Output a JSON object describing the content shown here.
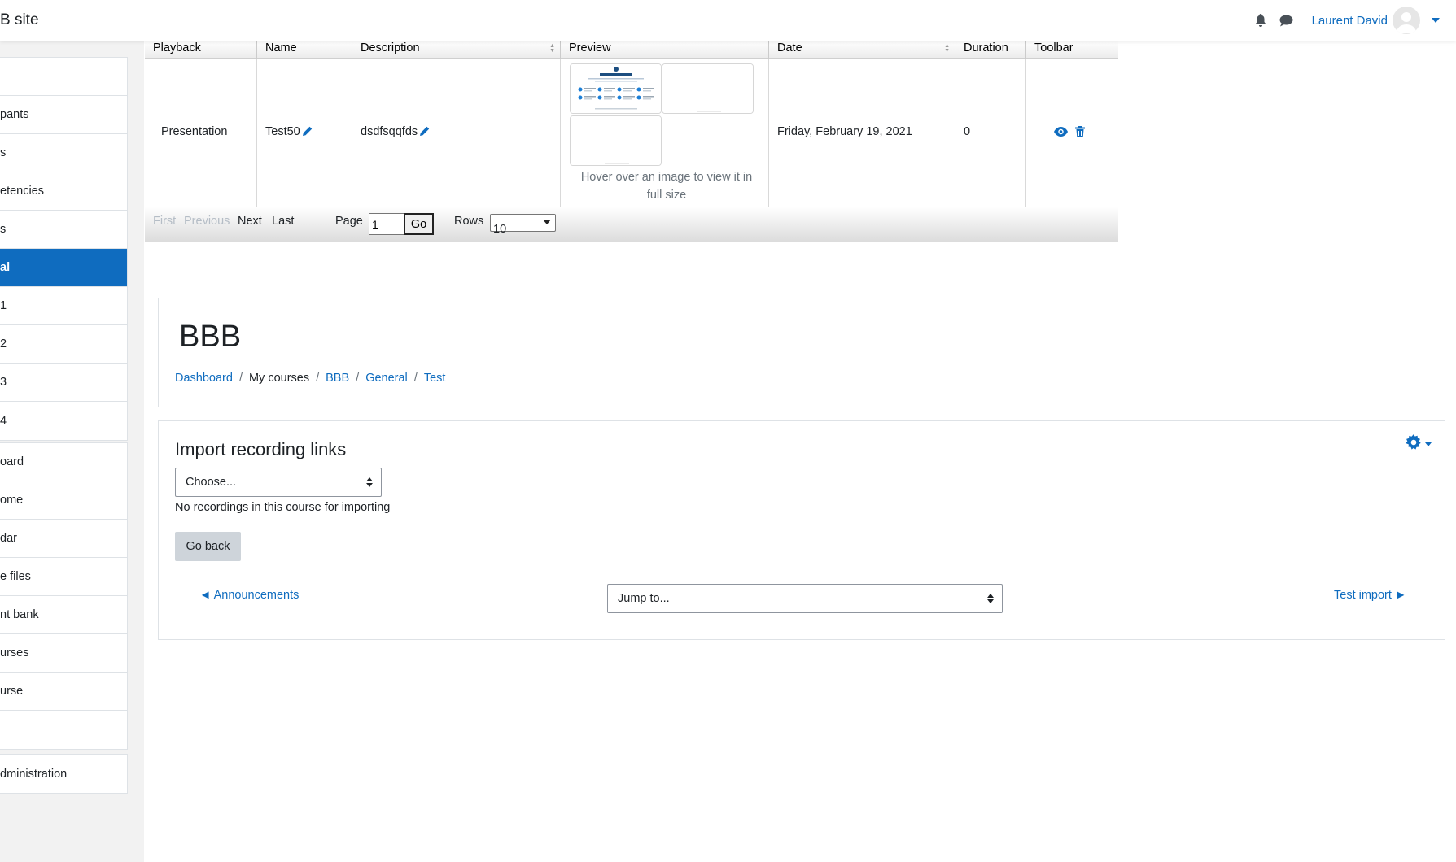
{
  "navbar": {
    "site_name": "B site",
    "user_name": "Laurent David"
  },
  "drawer": {
    "group1": [
      {
        "label": ""
      },
      {
        "label": "pants"
      },
      {
        "label": "s"
      },
      {
        "label": "etencies"
      },
      {
        "label": "s"
      },
      {
        "label": "al",
        "active": true
      },
      {
        "label": "1"
      },
      {
        "label": "2"
      },
      {
        "label": "3"
      },
      {
        "label": "4"
      }
    ],
    "group2": [
      {
        "label": "oard"
      },
      {
        "label": "ome"
      },
      {
        "label": "dar"
      },
      {
        "label": "e files"
      },
      {
        "label": "nt bank"
      },
      {
        "label": "urses"
      },
      {
        "label": "urse"
      },
      {
        "label": ""
      }
    ],
    "group3": [
      {
        "label": "dministration"
      }
    ]
  },
  "recordings": {
    "columns": [
      "Playback",
      "Name",
      "Description",
      "Preview",
      "Date",
      "Duration",
      "Toolbar"
    ],
    "row": {
      "playback": "Presentation",
      "name": "Test50",
      "description": "dsdfsqqfds",
      "preview_note": "Hover over an image to view it in full size",
      "date": "Friday, February 19, 2021",
      "duration": "0"
    },
    "pager": {
      "first": "First",
      "previous": "Previous",
      "next": "Next",
      "last": "Last",
      "page_label": "Page",
      "page_value": "1",
      "go": "Go",
      "rows_label": "Rows",
      "rows_value": "10"
    }
  },
  "header": {
    "title": "BBB",
    "breadcrumb": {
      "dashboard": "Dashboard",
      "my_courses": "My courses",
      "bbb": "BBB",
      "general": "General",
      "test": "Test"
    }
  },
  "import": {
    "title": "Import recording links",
    "select_value": "Choose...",
    "no_recordings": "No recordings in this course for importing",
    "go_back": "Go back",
    "prev_activity": "◄ Announcements",
    "jump_to": "Jump to...",
    "next_activity": "Test import ►"
  },
  "colors": {
    "accent": "#0f6cbf",
    "drawer_bg": "#f2f2f2",
    "border": "#dee2e6"
  }
}
